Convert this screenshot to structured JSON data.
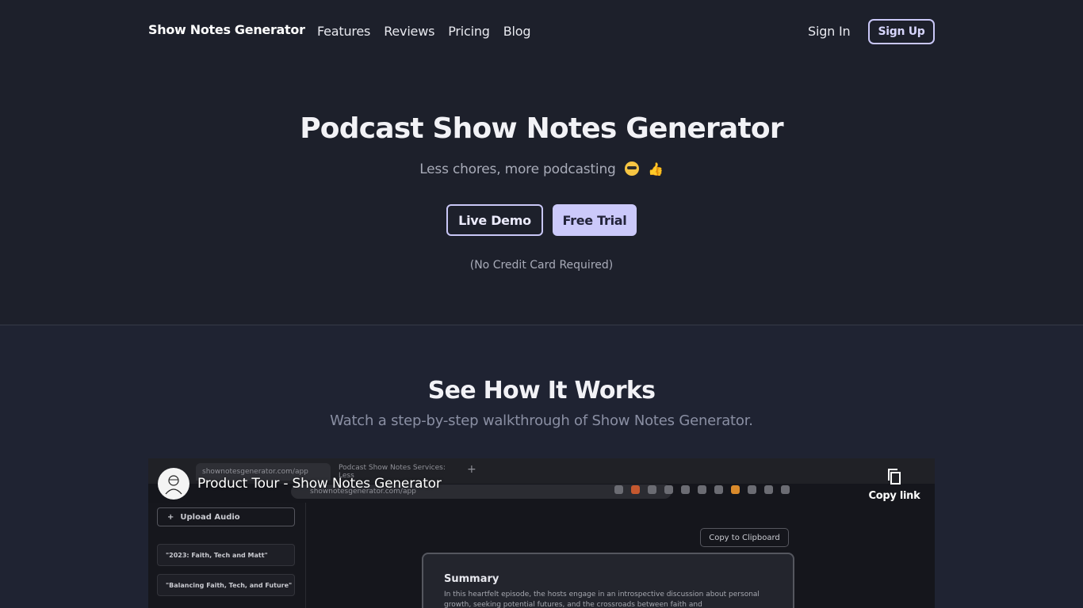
{
  "nav": {
    "brand": "Show Notes Generator",
    "links": [
      "Features",
      "Reviews",
      "Pricing",
      "Blog"
    ],
    "sign_in": "Sign In",
    "sign_up": "Sign Up"
  },
  "hero": {
    "title": "Podcast Show Notes Generator",
    "subtitle": "Less chores, more podcasting",
    "emoji_1": "smiling-face-with-sunglasses",
    "emoji_2": "👍",
    "demo_label": "Live Demo",
    "trial_label": "Free Trial",
    "note": "(No Credit Card Required)"
  },
  "how": {
    "title": "See How It Works",
    "subtitle": "Watch a step-by-step walkthrough of Show Notes Generator."
  },
  "video": {
    "title": "Product Tour - Show Notes Generator",
    "copy_link": "Copy link",
    "browser": {
      "tab_active": "shownotesgenerator.com/app",
      "tab_other": "Podcast Show Notes Services: Less",
      "tab_new": "+",
      "address": "shownotesgenerator.com/app"
    },
    "app": {
      "upload_label": "Upload Audio",
      "upload_icon": "+",
      "episodes": [
        "\"2023: Faith, Tech and Matt\"",
        "\"Balancing Faith, Tech, and Future\""
      ],
      "clipboard_label": "Copy to Clipboard",
      "summary_title": "Summary",
      "summary_text": "In this heartfelt episode, the hosts engage in an introspective discussion about personal growth, seeking potential futures, and the crossroads between faith and"
    }
  },
  "colors": {
    "background": "#1d202b",
    "section_bg": "#1f2332",
    "accent": "#cbc9fa",
    "muted_text": "#a8abb8"
  }
}
